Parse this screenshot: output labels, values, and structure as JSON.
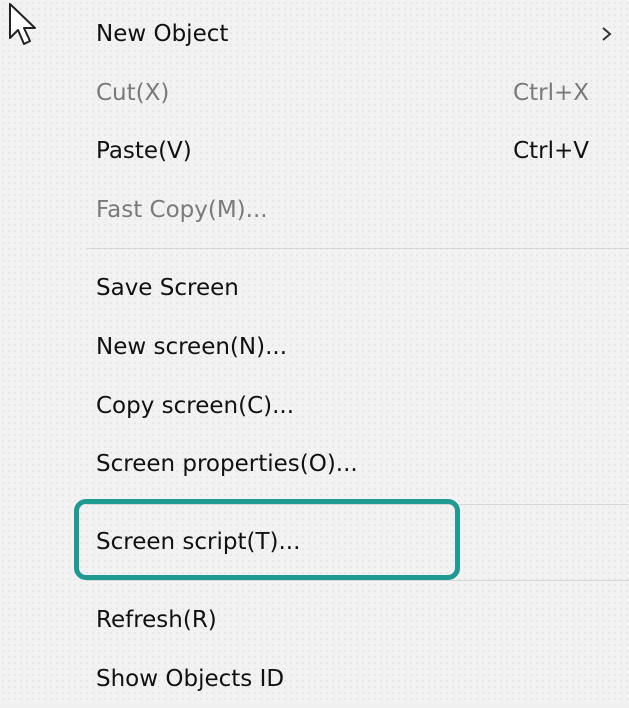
{
  "menu": {
    "items": [
      {
        "label": "New Object",
        "shortcut": "",
        "disabled": false,
        "submenu_icon": "chevron-right-icon"
      },
      {
        "label": "Cut(X)",
        "shortcut": "Ctrl+X",
        "disabled": true
      },
      {
        "label": "Paste(V)",
        "shortcut": "Ctrl+V",
        "disabled": false
      },
      {
        "label": "Fast Copy(M)...",
        "shortcut": "",
        "disabled": true
      },
      {
        "label": "Save Screen",
        "shortcut": "",
        "disabled": false
      },
      {
        "label": "New screen(N)...",
        "shortcut": "",
        "disabled": false
      },
      {
        "label": "Copy screen(C)...",
        "shortcut": "",
        "disabled": false
      },
      {
        "label": "Screen properties(O)...",
        "shortcut": "",
        "disabled": false
      },
      {
        "label": "Screen script(T)...",
        "shortcut": "",
        "disabled": false,
        "highlighted": true
      },
      {
        "label": "Refresh(R)",
        "shortcut": "",
        "disabled": false
      },
      {
        "label": "Show Objects ID",
        "shortcut": "",
        "disabled": false
      }
    ]
  },
  "colors": {
    "highlight_border": "#1f9a93",
    "disabled_text": "#7a7a7a"
  },
  "icons": {
    "cursor": "mouse-pointer-icon"
  }
}
